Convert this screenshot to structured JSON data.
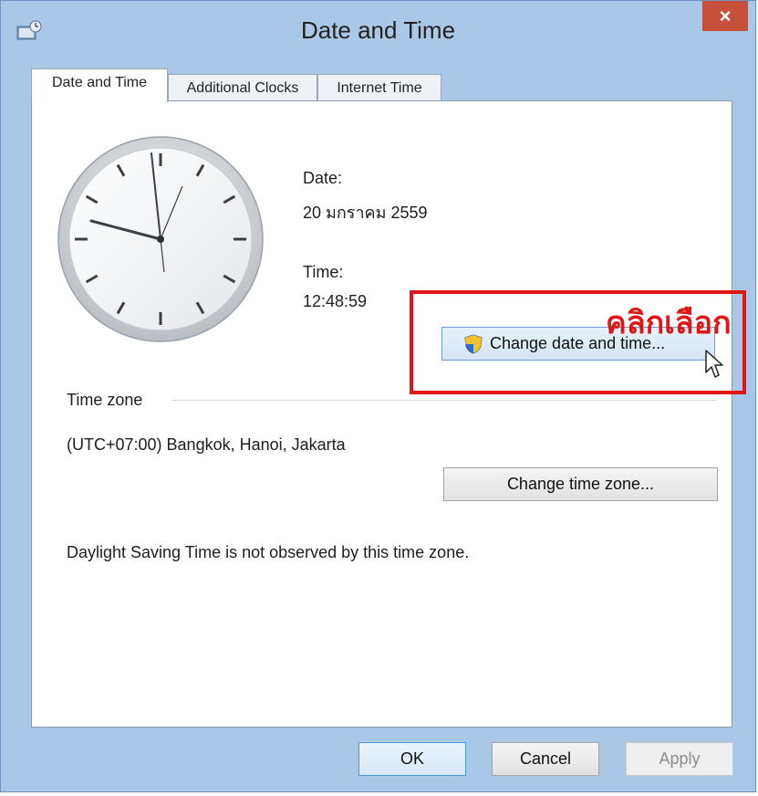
{
  "window": {
    "title": "Date and Time",
    "close_glyph": "×",
    "title_icon": "date-time-app-icon"
  },
  "tabs": [
    {
      "label": "Date and Time",
      "active": true
    },
    {
      "label": "Additional Clocks",
      "active": false
    },
    {
      "label": "Internet Time",
      "active": false
    }
  ],
  "datetime": {
    "date_label": "Date:",
    "date_value": "20 มกราคม 2559",
    "time_label": "Time:",
    "time_value": "12:48:59",
    "change_button": "Change date and time..."
  },
  "annotation": {
    "text": "คลิกเลือก",
    "color": "#e21515"
  },
  "timezone": {
    "section_label": "Time zone",
    "value": "(UTC+07:00) Bangkok, Hanoi, Jakarta",
    "change_button": "Change time zone...",
    "dst_note": "Daylight Saving Time is not observed by this time zone."
  },
  "footer": {
    "ok": "OK",
    "cancel": "Cancel",
    "apply": "Apply"
  },
  "colors": {
    "frame": "#a9c8e8",
    "close": "#c7503b",
    "highlight": "#e21515"
  }
}
